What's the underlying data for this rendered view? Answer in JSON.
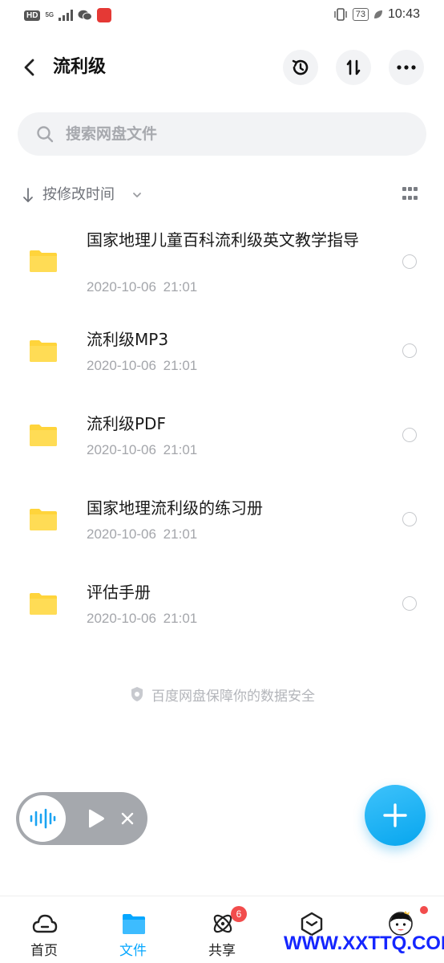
{
  "status_bar": {
    "hd": "HD",
    "net_type": "5G",
    "battery": "73",
    "time": "10:43"
  },
  "header": {
    "title": "流利级",
    "icons": [
      "back-arrow-icon",
      "history-icon",
      "sort-icon",
      "more-icon"
    ]
  },
  "search": {
    "placeholder": "搜索网盘文件"
  },
  "sort": {
    "label": "按修改时间"
  },
  "files": [
    {
      "name": "国家地理儿童百科流利级英文教学指导",
      "date": "2020-10-06  21:01",
      "icon": "folder-icon"
    },
    {
      "name": "流利级MP3",
      "date": "2020-10-06  21:01",
      "icon": "folder-icon"
    },
    {
      "name": "流利级PDF",
      "date": "2020-10-06  21:01",
      "icon": "folder-icon"
    },
    {
      "name": "国家地理流利级的练习册",
      "date": "2020-10-06  21:01",
      "icon": "folder-icon"
    },
    {
      "name": "评估手册",
      "date": "2020-10-06  21:01",
      "icon": "folder-icon"
    }
  ],
  "safety_note": "百度网盘保障你的数据安全",
  "bottom_nav": {
    "items": [
      {
        "label": "首页",
        "icon": "cloud-home-icon",
        "active": false
      },
      {
        "label": "文件",
        "icon": "folder-tab-icon",
        "active": true
      },
      {
        "label": "共享",
        "icon": "share-atom-icon",
        "active": false,
        "badge": "6"
      },
      {
        "label": "",
        "icon": "cube-icon",
        "active": false
      },
      {
        "label": "",
        "icon": "avatar-icon",
        "active": false
      }
    ]
  },
  "watermark": "WWW.XXTTQ.COM",
  "colors": {
    "accent": "#06a7ff",
    "folder": "#ffd43b",
    "badge": "#f24c4c"
  }
}
